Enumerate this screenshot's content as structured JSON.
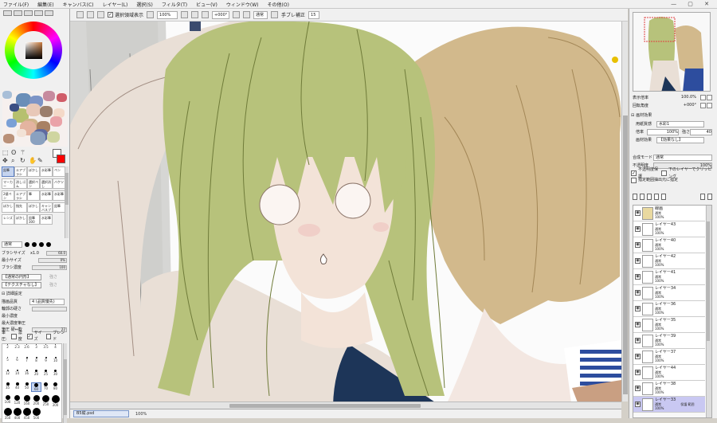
{
  "menu": [
    "ファイル(F)",
    "編集(E)",
    "キャンバス(C)",
    "レイヤー(L)",
    "選択(S)",
    "フィルタ(T)",
    "ビュー(V)",
    "ウィンドウ(W)",
    "その他(O)"
  ],
  "window_controls": "— ▢ ✕",
  "toolbar": {
    "show_selection_label": "選択領域表示",
    "zoom": "100%",
    "angle": "+000°",
    "mode": "通常",
    "stabilizer_label": "手ブレ補正",
    "stabilizer_value": "15"
  },
  "tools": {
    "brushes": [
      "鉛筆",
      "エアブラシ",
      "ぼかし",
      "水彩筆",
      "ペン",
      "マーカー",
      "消しゴム",
      "選択ペン",
      "選択消し",
      "バケツ",
      "2値ペン",
      "エアブラシ",
      "筆",
      "水彩筆",
      "水彩筆",
      "ぼかし",
      "指先",
      "ぼかし",
      "キャンバスブラシ",
      "鉛筆",
      "レンズ",
      "ぼかし",
      "鉛筆300",
      "水彩筆"
    ],
    "mode": "通常",
    "brush_size_label": "ブラシサイズ",
    "brush_size_multiplier": "x1.0",
    "brush_size_value": "60.0",
    "min_size_label": "最小サイズ",
    "min_size_value": "0%",
    "density_label": "ブラシ濃度",
    "density_value": "100",
    "shape_label": "【通常の円形】",
    "texture_label": "【テクスチャなし】",
    "strength_label": "強さ",
    "detail_label": "詳細設定",
    "quality_label": "描画品質",
    "quality_value": "4 (品質優先)",
    "edge_label": "輪郭の硬さ",
    "min_density_label": "最小濃度",
    "max_pressure_label": "最大濃度筆圧",
    "pressure_hard_label": "筆圧 硬⇔軟",
    "pressure_hard_value": "22",
    "pressure_opts": [
      "濃度",
      "サイズ",
      "ブレンド"
    ],
    "pressure_prefix": "筆圧:",
    "brush_sizes": [
      "2",
      "2.3",
      "2.6",
      "3",
      "3.5",
      "4",
      "5",
      "6",
      "7",
      "8",
      "9",
      "10",
      "12",
      "14",
      "16",
      "20",
      "25",
      "30",
      "35",
      "40",
      "50",
      "60",
      "70",
      "80",
      "100",
      "120",
      "160",
      "200",
      "250",
      "300",
      "350",
      "400",
      "450",
      "500"
    ],
    "brush_sizes_selected": "60"
  },
  "document": {
    "name": "B5縦.psd",
    "zoom": "100%"
  },
  "navigator": {
    "zoom_label": "表示倍率",
    "zoom_value": "100.0%",
    "angle_label": "回転角度",
    "angle_value": "+000°"
  },
  "layer_effects": {
    "title": "画材効果",
    "texture_label": "用紙質感",
    "texture_value": "水彩1",
    "scale_label": "倍率",
    "scale_value": "100%",
    "strength_label": "強さ",
    "strength_value": "40",
    "effect_label": "画材効果",
    "effect_value": "【効果なし】"
  },
  "layer_props": {
    "blend_mode_label": "合成モード",
    "blend_mode_value": "通常",
    "opacity_label": "不透明度",
    "opacity_value": "100%",
    "protect_label": "不透明度保護",
    "clip_label": "下のレイヤーでクリッピング",
    "select_source_label": "指定範囲抽出元に指定"
  },
  "layers": [
    {
      "name": "線画",
      "mode": "通常",
      "opacity": "100%",
      "folder": true
    },
    {
      "name": "レイヤー43",
      "mode": "通常",
      "opacity": "100%"
    },
    {
      "name": "レイヤー40",
      "mode": "通常",
      "opacity": "100%"
    },
    {
      "name": "レイヤー42",
      "mode": "通常",
      "opacity": "100%"
    },
    {
      "name": "レイヤー41",
      "mode": "通常",
      "opacity": "100%"
    },
    {
      "name": "レイヤー34",
      "mode": "通常",
      "opacity": "100%"
    },
    {
      "name": "レイヤー36",
      "mode": "通常",
      "opacity": "100%"
    },
    {
      "name": "レイヤー35",
      "mode": "通常",
      "opacity": "100%"
    },
    {
      "name": "レイヤー39",
      "mode": "通常",
      "opacity": "100%"
    },
    {
      "name": "レイヤー37",
      "mode": "通常",
      "opacity": "100%"
    },
    {
      "name": "レイヤー44",
      "mode": "通常",
      "opacity": "100%"
    },
    {
      "name": "レイヤー38",
      "mode": "通常",
      "opacity": "100%"
    },
    {
      "name": "レイヤー33",
      "mode": "通常",
      "opacity": "100%",
      "selected": true,
      "flags": "保護 範囲"
    }
  ],
  "colors": {
    "ui_bg": "#f0f0f0",
    "selection": "#c9c8f2",
    "hair_green": "#b7c27b",
    "hair_brown": "#d2b98c",
    "skin": "#f3e3d8",
    "shirt": "#e9dfd6",
    "navy": "#1d3558",
    "foreground_color": "#ffffff",
    "background_color": "#ff0000"
  }
}
